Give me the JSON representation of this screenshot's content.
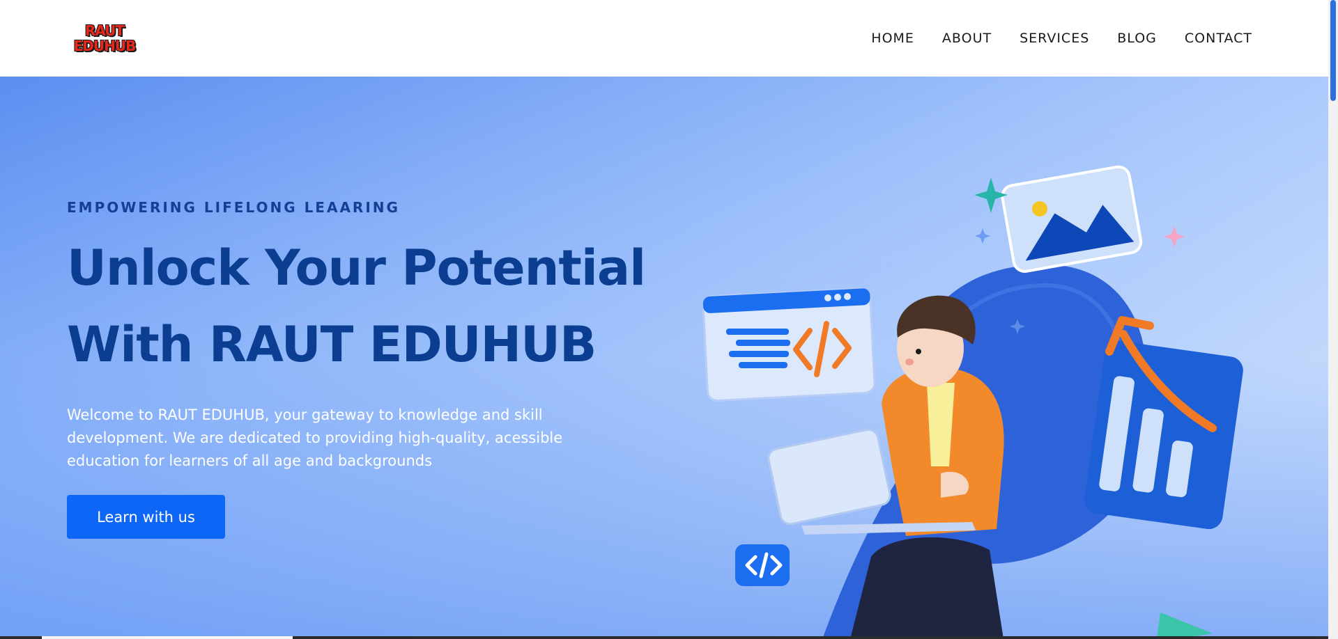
{
  "logo": {
    "line1": "RAUT",
    "line2": "EDUHUB"
  },
  "nav": {
    "items": [
      {
        "label": "HOME"
      },
      {
        "label": "ABOUT"
      },
      {
        "label": "SERVICES"
      },
      {
        "label": "BLOG"
      },
      {
        "label": "CONTACT"
      }
    ]
  },
  "hero": {
    "eyebrow": "EMPOWERING LIFELONG LEAARING",
    "headline_line1": "Unlock Your Potential",
    "headline_line2": "With RAUT EDUHUB",
    "intro": "Welcome to RAUT EDUHUB, your gateway to knowledge and skill development. We are dedicated to providing high-quality, acessible education for learners of all age and backgrounds",
    "cta_label": "Learn with us"
  },
  "colors": {
    "accent": "#0d66f5",
    "headline": "#0b3d91",
    "logo": "#e8271c"
  }
}
